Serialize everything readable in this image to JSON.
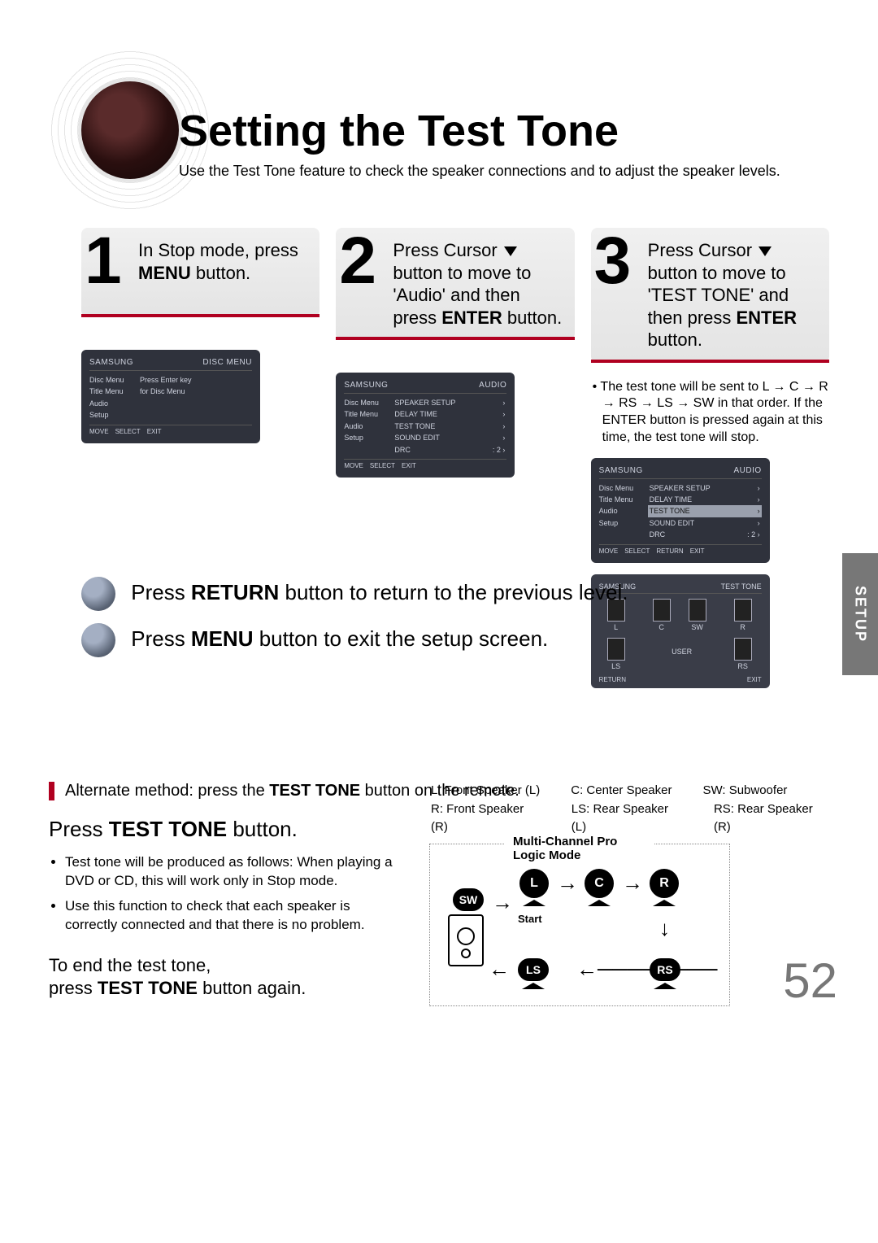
{
  "title": "Setting the Test Tone",
  "subtitle": "Use the Test Tone feature to check the speaker connections and to adjust the speaker levels.",
  "side_tab": "SETUP",
  "page_number": "52",
  "steps": {
    "s1": {
      "num": "1",
      "text_pre": "In Stop mode, press ",
      "text_bold": "MENU",
      "text_post": " button."
    },
    "s2": {
      "num": "2",
      "line1_pre": "Press Cursor ",
      "line2": "button to move to 'Audio' and then press ",
      "line2_bold": "ENTER",
      "line2_post": " button."
    },
    "s3": {
      "num": "3",
      "line1_pre": "Press Cursor ",
      "line1_post": " button to move to 'TEST TONE' and then press ",
      "line1_bold": "ENTER",
      "line1_end": " button."
    }
  },
  "note3": "• The test tone will be sent to L → C → R → RS → LS → SW in that order. If the ENTER button is pressed again at this time, the test tone will stop.",
  "osd_a": {
    "hl": "SAMSUNG",
    "hr": "DISC MENU",
    "left": [
      "Disc Menu",
      "Title Menu",
      "Audio",
      "Setup"
    ],
    "right_line1": "Press Enter key",
    "right_line2": "for Disc Menu",
    "foot": [
      "MOVE",
      "SELECT",
      "EXIT"
    ]
  },
  "osd_b": {
    "hl": "SAMSUNG",
    "hr": "AUDIO",
    "left": [
      "Disc Menu",
      "Title Menu",
      "Audio",
      "Setup"
    ],
    "items": [
      {
        "l": "SPEAKER SETUP",
        "r": "›"
      },
      {
        "l": "DELAY TIME",
        "r": "›"
      },
      {
        "l": "TEST TONE",
        "r": "›"
      },
      {
        "l": "SOUND EDIT",
        "r": "›"
      },
      {
        "l": "DRC",
        "r": ": 2          ›"
      }
    ],
    "foot": [
      "MOVE",
      "SELECT",
      "EXIT"
    ]
  },
  "osd_c": {
    "hl": "SAMSUNG",
    "hr": "AUDIO",
    "left": [
      "Disc Menu",
      "Title Menu",
      "Audio",
      "Setup"
    ],
    "items": [
      {
        "l": "SPEAKER SETUP",
        "r": "›"
      },
      {
        "l": "DELAY TIME",
        "r": "›"
      },
      {
        "l": "TEST TONE",
        "r": "›",
        "hl": true
      },
      {
        "l": "SOUND EDIT",
        "r": "›"
      },
      {
        "l": "DRC",
        "r": ": 2          ›"
      }
    ],
    "foot": [
      "MOVE",
      "SELECT",
      "RETURN",
      "EXIT"
    ]
  },
  "osd_d": {
    "hl": "SAMSUNG",
    "hr": "TEST TONE",
    "sp": {
      "l": "L",
      "c": "C",
      "r": "R",
      "ls": "LS",
      "rs": "RS",
      "sw": "SW",
      "user": "USER"
    },
    "foot": [
      "RETURN",
      "EXIT"
    ]
  },
  "return_line": {
    "pre": "Press ",
    "b": "RETURN",
    "post": " button to return to the previous level."
  },
  "menu_line": {
    "pre": "Press ",
    "b": "MENU",
    "post": " button to exit the setup screen."
  },
  "alt_line": {
    "pre": "Alternate method: press the ",
    "b": "TEST TONE",
    "post": " button on the remote."
  },
  "press_tt": {
    "pre": "Press ",
    "b": "TEST TONE",
    "post": " button."
  },
  "bullets": [
    "Test tone will be produced as follows: When playing a DVD or CD, this will work only in Stop mode.",
    "Use this function to check that each speaker is correctly connected and that there is no problem."
  ],
  "end": {
    "l1": "To end the test tone,",
    "l2_pre": "press ",
    "l2_b": "TEST TONE",
    "l2_post": " button again."
  },
  "legend": {
    "r1": [
      "L: Front Speaker (L)",
      "C: Center Speaker",
      "SW: Subwoofer"
    ],
    "r2": [
      "R: Front Speaker (R)",
      "LS: Rear Speaker (L)",
      "RS: Rear Speaker (R)"
    ]
  },
  "flow": {
    "title": "Multi-Channel Pro Logic Mode",
    "L": "L",
    "C": "C",
    "R": "R",
    "LS": "LS",
    "RS": "RS",
    "SW": "SW",
    "start": "Start"
  }
}
